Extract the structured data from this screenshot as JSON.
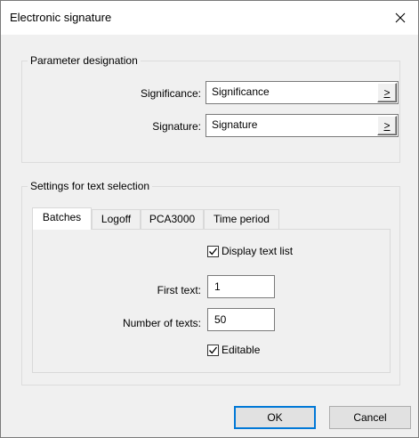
{
  "window": {
    "title": "Electronic signature"
  },
  "parameter_group": {
    "title": "Parameter designation",
    "significance": {
      "label": "Significance:",
      "value": "Significance",
      "browse": ">"
    },
    "signature": {
      "label": "Signature:",
      "value": "Signature",
      "browse": ">"
    }
  },
  "settings_group": {
    "title": "Settings for text selection",
    "tabs": [
      {
        "label": "Batches",
        "active": true
      },
      {
        "label": "Logoff",
        "active": false
      },
      {
        "label": "PCA3000",
        "active": false
      },
      {
        "label": "Time period",
        "active": false
      }
    ],
    "display_text_list": {
      "label": "Display text list",
      "checked": true
    },
    "first_text": {
      "label": "First text:",
      "value": "1"
    },
    "number_of_texts": {
      "label": "Number of texts:",
      "value": "50"
    },
    "editable": {
      "label": "Editable",
      "checked": true
    }
  },
  "buttons": {
    "ok": "OK",
    "cancel": "Cancel"
  },
  "icons": {
    "close": "close-icon",
    "check": "checkmark-icon"
  }
}
